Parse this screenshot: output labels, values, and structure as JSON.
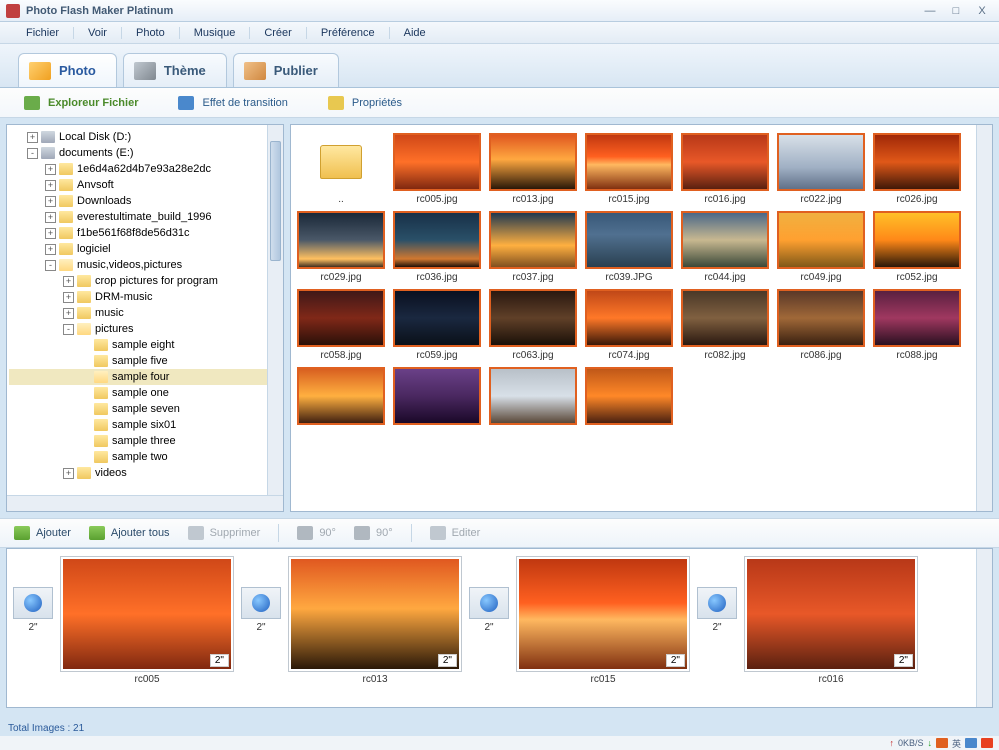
{
  "window": {
    "title": "Photo Flash Maker Platinum",
    "minimize": "—",
    "maximize": "□",
    "close": "X"
  },
  "menu": [
    "Fichier",
    "Voir",
    "Photo",
    "Musique",
    "Créer",
    "Préférence",
    "Aide"
  ],
  "main_tabs": [
    {
      "label": "Photo",
      "active": true,
      "icon": "ico-photo"
    },
    {
      "label": "Thème",
      "active": false,
      "icon": "ico-theme"
    },
    {
      "label": "Publier",
      "active": false,
      "icon": "ico-publish"
    }
  ],
  "sub_tabs": [
    {
      "label": "Exploreur Fichier",
      "active": true
    },
    {
      "label": "Effet de transition",
      "active": false
    },
    {
      "label": "Propriétés",
      "active": false
    }
  ],
  "tree": [
    {
      "depth": 1,
      "exp": "+",
      "icon": "ico-drive",
      "label": "Local Disk (D:)"
    },
    {
      "depth": 1,
      "exp": "-",
      "icon": "ico-drive",
      "label": "documents (E:)"
    },
    {
      "depth": 2,
      "exp": "+",
      "icon": "ico-folder",
      "label": "1e6d4a62d4b7e93a28e2dc"
    },
    {
      "depth": 2,
      "exp": "+",
      "icon": "ico-folder",
      "label": "Anvsoft"
    },
    {
      "depth": 2,
      "exp": "+",
      "icon": "ico-folder",
      "label": "Downloads"
    },
    {
      "depth": 2,
      "exp": "+",
      "icon": "ico-folder",
      "label": "everestultimate_build_1996"
    },
    {
      "depth": 2,
      "exp": "+",
      "icon": "ico-folder",
      "label": "f1be561f68f8de56d31c"
    },
    {
      "depth": 2,
      "exp": "+",
      "icon": "ico-folder",
      "label": "logiciel"
    },
    {
      "depth": 2,
      "exp": "-",
      "icon": "ico-folder-open",
      "label": "music,videos,pictures"
    },
    {
      "depth": 3,
      "exp": "+",
      "icon": "ico-folder",
      "label": "crop pictures for program"
    },
    {
      "depth": 3,
      "exp": "+",
      "icon": "ico-folder",
      "label": "DRM-music"
    },
    {
      "depth": 3,
      "exp": "+",
      "icon": "ico-folder",
      "label": "music"
    },
    {
      "depth": 3,
      "exp": "-",
      "icon": "ico-folder-open",
      "label": "pictures"
    },
    {
      "depth": 4,
      "exp": "",
      "icon": "ico-folder",
      "label": "sample eight"
    },
    {
      "depth": 4,
      "exp": "",
      "icon": "ico-folder",
      "label": "sample five"
    },
    {
      "depth": 4,
      "exp": "",
      "icon": "ico-folder-open",
      "label": "sample four",
      "selected": true
    },
    {
      "depth": 4,
      "exp": "",
      "icon": "ico-folder",
      "label": "sample one"
    },
    {
      "depth": 4,
      "exp": "",
      "icon": "ico-folder",
      "label": "sample seven"
    },
    {
      "depth": 4,
      "exp": "",
      "icon": "ico-folder",
      "label": "sample six01"
    },
    {
      "depth": 4,
      "exp": "",
      "icon": "ico-folder",
      "label": "sample three"
    },
    {
      "depth": 4,
      "exp": "",
      "icon": "ico-folder",
      "label": "sample two"
    },
    {
      "depth": 3,
      "exp": "+",
      "icon": "ico-folder",
      "label": "videos"
    }
  ],
  "gallery": [
    {
      "label": "..",
      "folder": true
    },
    {
      "label": "rc005.jpg",
      "cls": "g1"
    },
    {
      "label": "rc013.jpg",
      "cls": "g2"
    },
    {
      "label": "rc015.jpg",
      "cls": "g3"
    },
    {
      "label": "rc016.jpg",
      "cls": "g4"
    },
    {
      "label": "rc022.jpg",
      "cls": "g5"
    },
    {
      "label": "rc026.jpg",
      "cls": "g6"
    },
    {
      "label": "rc029.jpg",
      "cls": "g7"
    },
    {
      "label": "rc036.jpg",
      "cls": "g8"
    },
    {
      "label": "rc037.jpg",
      "cls": "g9"
    },
    {
      "label": "rc039.JPG",
      "cls": "g10"
    },
    {
      "label": "rc044.jpg",
      "cls": "g11"
    },
    {
      "label": "rc049.jpg",
      "cls": "g12"
    },
    {
      "label": "rc052.jpg",
      "cls": "g13"
    },
    {
      "label": "rc058.jpg",
      "cls": "g14"
    },
    {
      "label": "rc059.jpg",
      "cls": "g15"
    },
    {
      "label": "rc063.jpg",
      "cls": "g16"
    },
    {
      "label": "rc074.jpg",
      "cls": "g17"
    },
    {
      "label": "rc082.jpg",
      "cls": "g18"
    },
    {
      "label": "rc086.jpg",
      "cls": "g19"
    },
    {
      "label": "rc088.jpg",
      "cls": "g20"
    },
    {
      "label": "",
      "cls": "g21"
    },
    {
      "label": "",
      "cls": "g22"
    },
    {
      "label": "",
      "cls": "g23"
    },
    {
      "label": "",
      "cls": "g24"
    }
  ],
  "actions": {
    "add": "Ajouter",
    "add_all": "Ajouter tous",
    "delete": "Supprimer",
    "rotate_cw": "90°",
    "rotate_ccw": "90°",
    "edit": "Editer"
  },
  "timeline": [
    {
      "trans_dur": "2\"",
      "caption": "rc005",
      "img_dur": "2\"",
      "cls": "g1"
    },
    {
      "trans_dur": "2\"",
      "caption": "rc013",
      "img_dur": "2\"",
      "cls": "g2"
    },
    {
      "trans_dur": "2\"",
      "caption": "rc015",
      "img_dur": "2\"",
      "cls": "g3"
    },
    {
      "trans_dur": "2\"",
      "caption": "rc016",
      "img_dur": "2\"",
      "cls": "g4"
    }
  ],
  "status": {
    "total_images_label": "Total Images :",
    "total_images_count": "21",
    "net_speed": "0KB/S",
    "ime": "英"
  }
}
